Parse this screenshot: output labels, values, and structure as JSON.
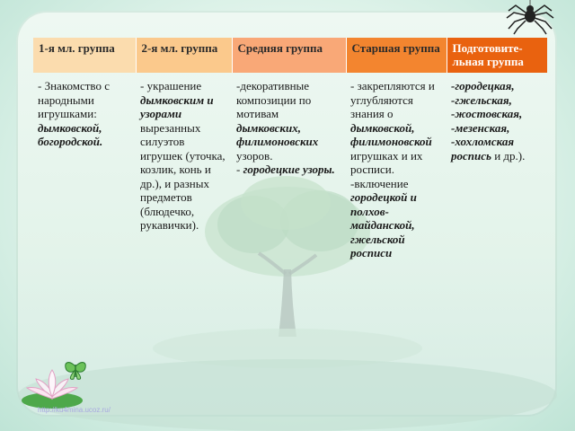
{
  "table": {
    "headers": [
      "1-я мл. группа",
      "2-я мл. группа",
      "Средняя группа",
      "Старшая группа",
      "Подготовите-льная группа"
    ],
    "columns": [
      [
        {
          "t": "- Знакомство с народными игрушками: ",
          "s": "plain"
        },
        {
          "t": "дымковской, богородской.",
          "s": "bi"
        }
      ],
      [
        {
          "t": "- украшение ",
          "s": "plain"
        },
        {
          "t": "дымковским и узорами",
          "s": "bi"
        },
        {
          "t": " вырезанных силуэтов игрушек (уточка, козлик, конь и др.), и разных предметов (блюдечко, рукавички).",
          "s": "plain"
        }
      ],
      [
        {
          "t": "-декоративные композиции по мотивам ",
          "s": "plain"
        },
        {
          "t": "дымковских, филимоновских",
          "s": "bi"
        },
        {
          "t": " узоров.\n- ",
          "s": "plain"
        },
        {
          "t": "городецкие узоры.",
          "s": "bi"
        }
      ],
      [
        {
          "t": "- закрепляются и углубляются знания о ",
          "s": "plain"
        },
        {
          "t": "дымковской, филимоновской",
          "s": "bi"
        },
        {
          "t": " игрушках и их росписи.\n-включение ",
          "s": "plain"
        },
        {
          "t": "городецкой и полхов-майданской, гжельской росписи",
          "s": "bi"
        }
      ],
      [
        {
          "t": "-городецкая,\n-гжельская,\n-жостовская,\n -мезенская,\n-хохломская роспись",
          "s": "bi"
        },
        {
          "t": " и др.).",
          "s": "plain"
        }
      ]
    ]
  },
  "watermark": "http://ku4mina.ucoz.ru/",
  "colors": {
    "header_1": "#fbdcae",
    "header_2": "#fbc98c",
    "header_3": "#f9a877",
    "header_4": "#f3852f",
    "header_5": "#e9620f"
  },
  "decorations": [
    "tree-image",
    "spider-icon",
    "lotus-butterfly-icon"
  ]
}
